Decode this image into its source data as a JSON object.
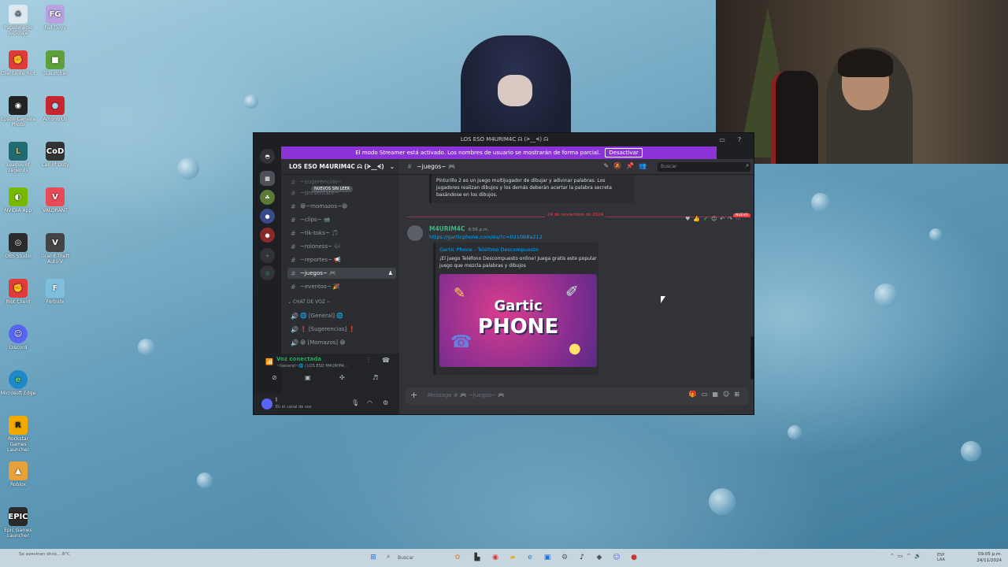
{
  "desktop": {
    "icons": [
      {
        "label": "Papelera de reciclaje",
        "icon": "recycle-bin-icon",
        "color": "#dfe8ee"
      },
      {
        "label": "Fall Guys",
        "icon": "fall-guys-icon",
        "color": "#b8a2e0"
      },
      {
        "label": "Cliente de Riot",
        "icon": "riot-client-icon",
        "color": "#e03b3b"
      },
      {
        "label": "TLauncher",
        "icon": "minecraft-icon",
        "color": "#5ea03b"
      },
      {
        "label": "Epson Camera Photo",
        "icon": "camera-icon",
        "color": "#222222"
      },
      {
        "label": "Among Us",
        "icon": "among-us-icon",
        "color": "#c8262e"
      },
      {
        "label": "League of Legends",
        "icon": "lol-icon",
        "color": "#1f6b6f"
      },
      {
        "label": "Call of Duty",
        "icon": "cod-icon",
        "color": "#333333"
      },
      {
        "label": "NVIDIA App",
        "icon": "nvidia-icon",
        "color": "#76b900"
      },
      {
        "label": "VALORANT",
        "icon": "valorant-icon",
        "color": "#e84a57"
      },
      {
        "label": "OBS Studio",
        "icon": "obs-icon",
        "color": "#2b2b2b"
      },
      {
        "label": "Grand Theft Auto V",
        "icon": "gta-icon",
        "color": "#444444"
      },
      {
        "label": "Riot Client",
        "icon": "riot-icon",
        "color": "#e03b3b"
      },
      {
        "label": "Fortnite",
        "icon": "fortnite-icon",
        "color": "#7fbfdc"
      },
      {
        "label": "Discord",
        "icon": "discord-icon",
        "color": "#5865f2"
      },
      {
        "label": "Microsoft Edge",
        "icon": "edge-icon",
        "color": "#1e88c8"
      },
      {
        "label": "Rockstar Games Launcher",
        "icon": "rockstar-icon",
        "color": "#f2a900"
      },
      {
        "label": "Roblox",
        "icon": "roblox-icon",
        "color": "#e8a03b"
      },
      {
        "label": "Epic Games Launcher",
        "icon": "epic-icon",
        "color": "#2a2a2a"
      }
    ]
  },
  "discord": {
    "window_title": "LOS ESO M4URIM4C ᗣ (ᗒ__ᗕ) ᗣ",
    "banner_text": "El modo Streamer está activado. Los nombres de usuario se mostrarán de forma parcial.",
    "banner_button": "Desactivar",
    "server_name": "LOS ESO M4URIM4C ᗣ (ᗒ__ᗕ)",
    "new_unreads": "NUEVOS SIN LEER",
    "channels": [
      {
        "name": "~sugerencias~",
        "active": false
      },
      {
        "name": "~presentate~",
        "active": false
      },
      {
        "name": "😁~momazos~😁",
        "active": false
      },
      {
        "name": "~clips~ 📹",
        "active": false
      },
      {
        "name": "~tik-toks~ 🎵",
        "active": false
      },
      {
        "name": "~roloness~ 🎶",
        "active": false
      },
      {
        "name": "~reportes~ 📢",
        "active": false
      },
      {
        "name": "~juegos~ 🎮",
        "active": true
      },
      {
        "name": "~eventos~ 🎉",
        "active": false
      }
    ],
    "voice_category": "CHAT DE VOZ ~",
    "voice_channels": [
      {
        "name": "🌐 [General] 🌐"
      },
      {
        "name": "❗ [Sugerencias] ❗"
      },
      {
        "name": "😁 [Momazos] 😁"
      }
    ],
    "voice_status": "Voz conectada",
    "voice_channel_path": "~General~🌐 / LOS ESO M4URIM4...",
    "user_name": "l",
    "user_status": "En el canal de voz",
    "current_channel": "~juegos~ 🎮",
    "search_placeholder": "Buscar",
    "previous_embed_text": "Pinturillo 2 es un juego multijugador de dibujar y adivinar palabras. Los jugadores realizan dibujos y los demás deberán acertar la palabra secreta basándose en los dibujos.",
    "date_divider": "24 de noviembre de 2024",
    "new_label": "NUEVO",
    "message": {
      "author": "M4URIM4C",
      "time": "8:56 p.m.",
      "link": "https://garticphone.com/es/?c=0210b8a212",
      "embed_title": "Gartic Phone - Teléfono Descompuesto",
      "embed_desc": "¡El juego Teléfono Descompuesto online! Juega gratis este popular juego que mezcla palabras y dibujos",
      "image_word1": "Gartic",
      "image_word2": "PHONE"
    },
    "composer_placeholder": "Message # 🎮 ~juegos~ 🎮"
  },
  "taskbar": {
    "weather": "Se avecinan divis... 8°C",
    "search": "Buscar",
    "tray_lang": "ESP LAA",
    "time": "09:05 p.m.",
    "date": "24/11/2024"
  }
}
